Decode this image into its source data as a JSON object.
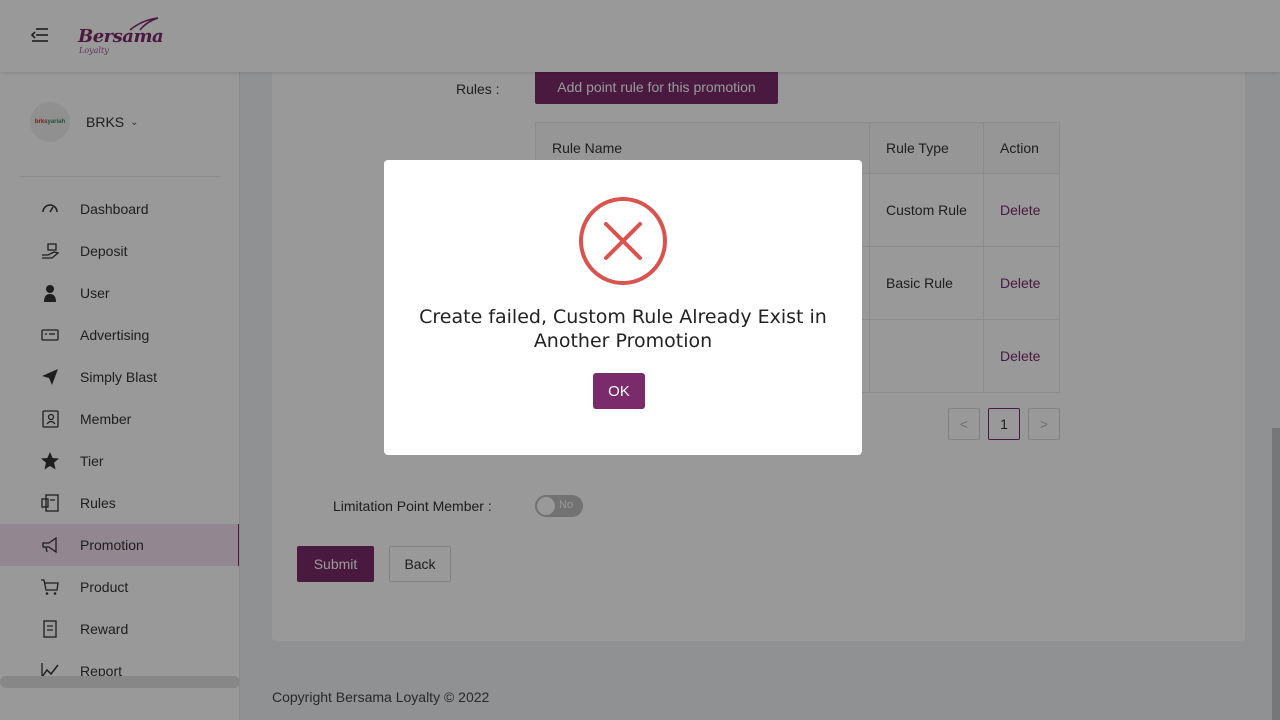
{
  "brand": {
    "name": "Bersama",
    "tagline": "Loyalty"
  },
  "account": {
    "avatar_text_red": "brks",
    "avatar_text_green": "yariah",
    "name": "BRKS"
  },
  "sidebar": {
    "items": [
      {
        "label": "Dashboard",
        "icon": "dashboard-gauge-icon"
      },
      {
        "label": "Deposit",
        "icon": "deposit-hand-icon"
      },
      {
        "label": "User",
        "icon": "user-icon"
      },
      {
        "label": "Advertising",
        "icon": "advertising-card-icon"
      },
      {
        "label": "Simply Blast",
        "icon": "paper-plane-icon"
      },
      {
        "label": "Member",
        "icon": "member-contact-icon"
      },
      {
        "label": "Tier",
        "icon": "star-icon"
      },
      {
        "label": "Rules",
        "icon": "rules-document-icon"
      },
      {
        "label": "Promotion",
        "icon": "megaphone-icon",
        "active": true
      },
      {
        "label": "Product",
        "icon": "cart-icon"
      },
      {
        "label": "Reward",
        "icon": "reward-receipt-icon"
      },
      {
        "label": "Report",
        "icon": "chart-line-icon"
      }
    ]
  },
  "form": {
    "rules_label": "Rules :",
    "add_rule_button": "Add point rule for this promotion",
    "table": {
      "headers": [
        "Rule Name",
        "Rule Type",
        "Action"
      ],
      "rows": [
        {
          "name": "",
          "type": "Custom Rule",
          "action": "Delete"
        },
        {
          "name": "",
          "type": "Basic Rule",
          "action": "Delete"
        },
        {
          "name": "",
          "type": "",
          "action": "Delete"
        }
      ]
    },
    "pagination": {
      "prev": "<",
      "current": "1",
      "next": ">"
    },
    "limitation_label": "Limitation Point Member :",
    "limitation_toggle": "No",
    "submit_button": "Submit",
    "back_button": "Back"
  },
  "footer": {
    "text": "Copyright Bersama Loyalty © 2022"
  },
  "modal": {
    "icon": "error-x-circle-icon",
    "message": "Create failed, Custom Rule Already Exist in Another Promotion",
    "ok_button": "OK"
  },
  "colors": {
    "brand": "#7b2a6b",
    "active_bg": "#f3dff0",
    "error": "#d9534f"
  }
}
